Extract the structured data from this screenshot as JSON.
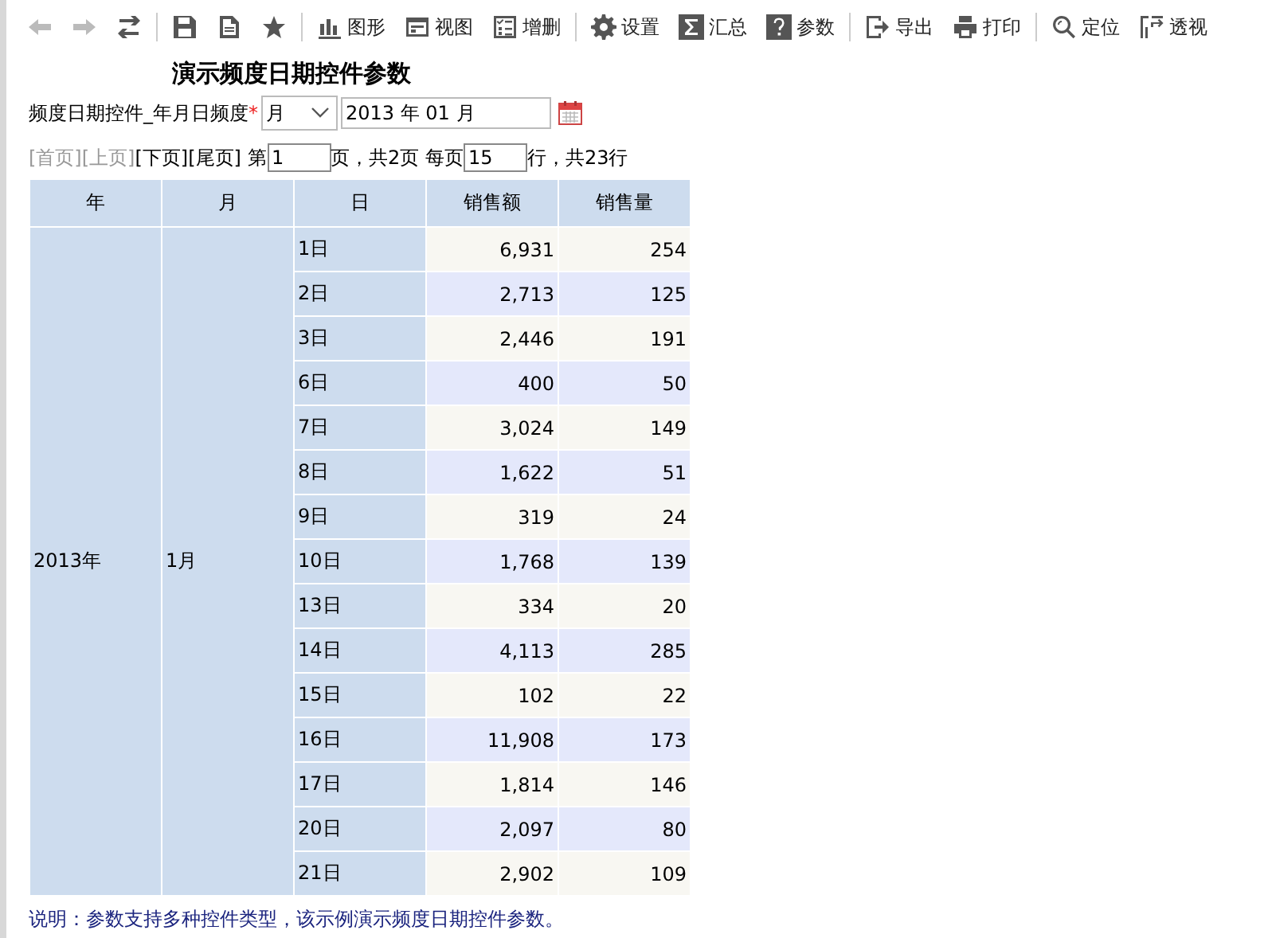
{
  "toolbar_groups": [
    [
      {
        "disabled": true
      },
      {
        "disabled": true
      },
      {
        "disabled": false
      }
    ],
    [
      {
        "disabled": false
      },
      {
        "disabled": false
      },
      {
        "disabled": false
      }
    ],
    [
      {
        "label": "图形",
        "disabled": false
      },
      {
        "label": "视图",
        "disabled": false
      },
      {
        "label": "增删",
        "disabled": false
      }
    ],
    [
      {
        "label": "设置",
        "disabled": false
      },
      {
        "label": "汇总",
        "disabled": false
      },
      {
        "label": "参数",
        "disabled": false
      }
    ],
    [
      {
        "label": "导出",
        "disabled": false
      },
      {
        "label": "打印",
        "disabled": false
      }
    ],
    [
      {
        "label": "定位",
        "disabled": false
      },
      {
        "label": "透视",
        "disabled": false
      }
    ]
  ],
  "title": "演示频度日期控件参数",
  "param": {
    "label": "频度日期控件_年月日频度",
    "required_mark": "*",
    "frequency": "月",
    "date": "2013 年 01 月"
  },
  "pager": {
    "links": [
      {
        "label": "[首页]",
        "disabled": true
      },
      {
        "label": "[上页]",
        "disabled": true
      },
      {
        "label": "[下页]",
        "disabled": false
      },
      {
        "label": "[尾页]",
        "disabled": false
      }
    ],
    "before_page": "第",
    "page": "1",
    "after_page": "页，共2页 每页",
    "rows_per_page": "15",
    "after_rows": "行，共23行"
  },
  "table": {
    "columns": [
      "年",
      "月",
      "日",
      "销售额",
      "销售量"
    ],
    "rows": [
      [
        {
          "text": "2013年",
          "rowspan": 15
        },
        {
          "text": "1月",
          "rowspan": 15
        },
        "1日",
        "6,931",
        "254"
      ],
      [
        "2日",
        "2,713",
        "125"
      ],
      [
        "3日",
        "2,446",
        "191"
      ],
      [
        "6日",
        "400",
        "50"
      ],
      [
        "7日",
        "3,024",
        "149"
      ],
      [
        "8日",
        "1,622",
        "51"
      ],
      [
        "9日",
        "319",
        "24"
      ],
      [
        "10日",
        "1,768",
        "139"
      ],
      [
        "13日",
        "334",
        "20"
      ],
      [
        "14日",
        "4,113",
        "285"
      ],
      [
        "15日",
        "102",
        "22"
      ],
      [
        "16日",
        "11,908",
        "173"
      ],
      [
        "17日",
        "1,814",
        "146"
      ],
      [
        "20日",
        "2,097",
        "80"
      ],
      [
        "21日",
        "2,902",
        "109"
      ]
    ]
  },
  "note": "说明：参数支持多种控件类型，该示例演示频度日期控件参数。"
}
